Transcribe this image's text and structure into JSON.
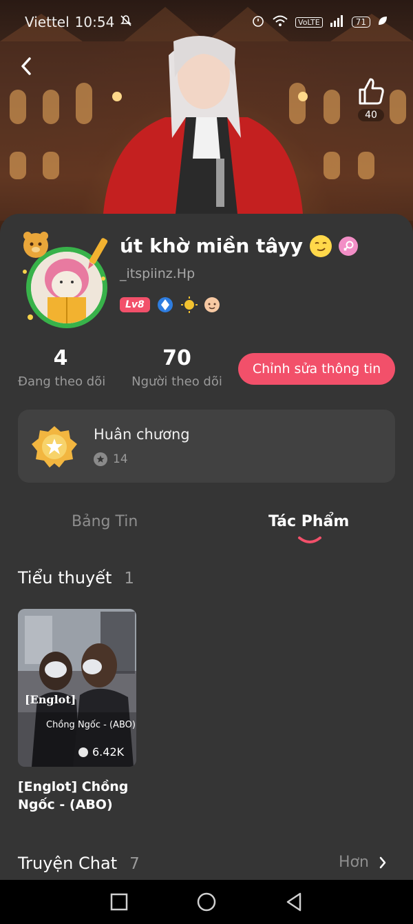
{
  "status_bar": {
    "carrier": "Viettel",
    "time": "10:54",
    "network_label": "VoLTE",
    "battery": "71"
  },
  "profile": {
    "display_name": "út khờ miền tâyy",
    "username": "_itspiinz.Hp",
    "level": "Lv8",
    "like_count": "40"
  },
  "stats": {
    "following_count": "4",
    "following_label": "Đang theo dõi",
    "followers_count": "70",
    "followers_label": "Người theo dõi"
  },
  "edit_button_label": "Chỉnh sửa thông tin",
  "medal": {
    "title": "Huân chương",
    "count": "14"
  },
  "tabs": {
    "feed": "Bảng Tin",
    "works": "Tác Phẩm",
    "active": "works"
  },
  "novels_section": {
    "title": "Tiểu thuyết",
    "count": "1",
    "items": [
      {
        "cover_tag": "[Englot]",
        "cover_title": "Chồng Ngốc - (ABO)",
        "views": "6.42K",
        "name": "[Englot] Chồng Ngốc - (ABO)"
      }
    ]
  },
  "chat_section": {
    "title": "Truyện Chat",
    "count": "7",
    "more_label": "Hơn"
  },
  "colors": {
    "accent": "#f2506a",
    "sheet_bg": "#353535",
    "card_bg": "#414141",
    "avatar_ring": "#38b24a"
  }
}
